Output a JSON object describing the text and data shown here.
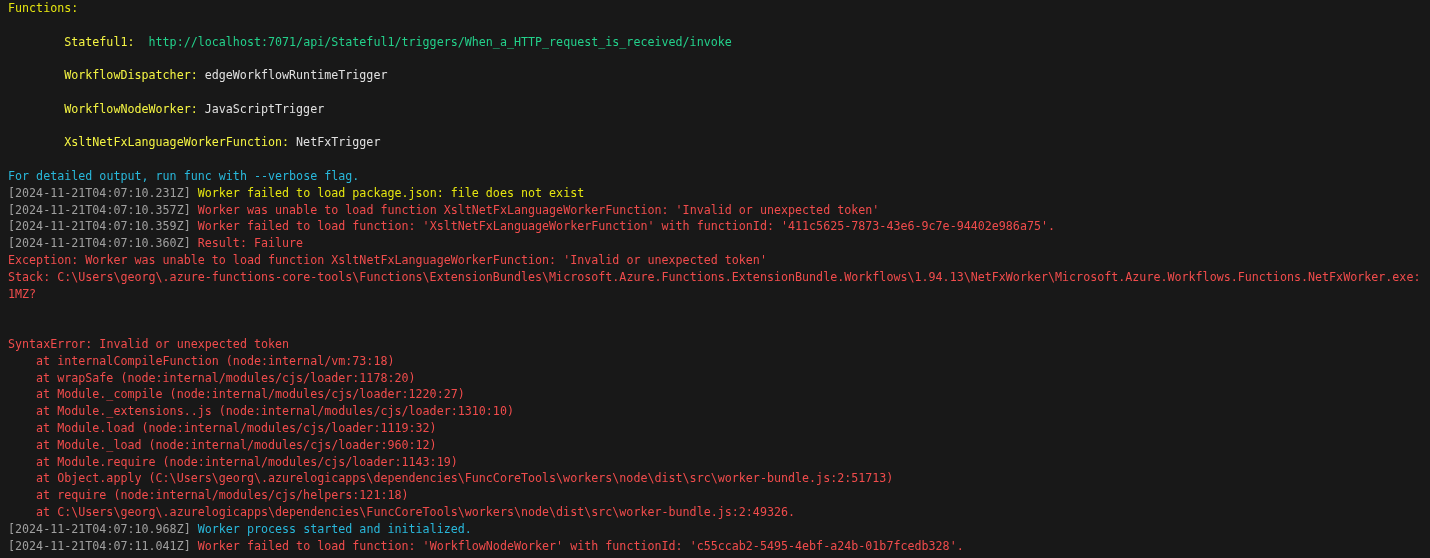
{
  "functions": {
    "heading": "Functions:",
    "items": [
      {
        "name": "Stateful1:",
        "trigger": "http://localhost:7071/api/Stateful1/triggers/When_a_HTTP_request_is_received/invoke",
        "kind": "url"
      },
      {
        "name": "WorkflowDispatcher:",
        "trigger": "edgeWorkflowRuntimeTrigger",
        "kind": "text"
      },
      {
        "name": "WorkflowNodeWorker:",
        "trigger": "JavaScriptTrigger",
        "kind": "text"
      },
      {
        "name": "XsltNetFxLanguageWorkerFunction:",
        "trigger": "NetFxTrigger",
        "kind": "text"
      }
    ]
  },
  "hint": "For detailed output, run func with --verbose flag.",
  "log": [
    {
      "kind": "entry",
      "timestamp": "[2024-11-21T04:07:10.231Z]",
      "message": "Worker failed to load package.json: file does not exist",
      "color": "#e5e510"
    },
    {
      "kind": "entry",
      "timestamp": "[2024-11-21T04:07:10.357Z]",
      "message": "Worker was unable to load function XsltNetFxLanguageWorkerFunction: 'Invalid or unexpected token'",
      "color": "#f14c4c"
    },
    {
      "kind": "entry",
      "timestamp": "[2024-11-21T04:07:10.359Z]",
      "message": "Worker failed to load function: 'XsltNetFxLanguageWorkerFunction' with functionId: '411c5625-7873-43e6-9c7e-94402e986a75'.",
      "color": "#f14c4c"
    },
    {
      "kind": "entry",
      "timestamp": "[2024-11-21T04:07:10.360Z]",
      "message": "Result: Failure",
      "color": "#f14c4c"
    },
    {
      "kind": "text",
      "text": "Exception: Worker was unable to load function XsltNetFxLanguageWorkerFunction: 'Invalid or unexpected token'",
      "color": "#f14c4c"
    },
    {
      "kind": "text",
      "text": "Stack: C:\\Users\\georg\\.azure-functions-core-tools\\Functions\\ExtensionBundles\\Microsoft.Azure.Functions.ExtensionBundle.Workflows\\1.94.13\\NetFxWorker\\Microsoft.Azure.Workflows.Functions.NetFxWorker.exe:1MZ?",
      "color": "#f14c4c"
    },
    {
      "kind": "gap"
    },
    {
      "kind": "gap"
    },
    {
      "kind": "text",
      "text": "SyntaxError: Invalid or unexpected token",
      "color": "#f14c4c"
    },
    {
      "kind": "frame",
      "text": "at internalCompileFunction (node:internal/vm:73:18)",
      "color": "#f14c4c"
    },
    {
      "kind": "frame",
      "text": "at wrapSafe (node:internal/modules/cjs/loader:1178:20)",
      "color": "#f14c4c"
    },
    {
      "kind": "frame",
      "text": "at Module._compile (node:internal/modules/cjs/loader:1220:27)",
      "color": "#f14c4c"
    },
    {
      "kind": "frame",
      "text": "at Module._extensions..js (node:internal/modules/cjs/loader:1310:10)",
      "color": "#f14c4c"
    },
    {
      "kind": "frame",
      "text": "at Module.load (node:internal/modules/cjs/loader:1119:32)",
      "color": "#f14c4c"
    },
    {
      "kind": "frame",
      "text": "at Module._load (node:internal/modules/cjs/loader:960:12)",
      "color": "#f14c4c"
    },
    {
      "kind": "frame",
      "text": "at Module.require (node:internal/modules/cjs/loader:1143:19)",
      "color": "#f14c4c"
    },
    {
      "kind": "frame",
      "text": "at Object.apply (C:\\Users\\georg\\.azurelogicapps\\dependencies\\FuncCoreTools\\workers\\node\\dist\\src\\worker-bundle.js:2:51713)",
      "color": "#f14c4c"
    },
    {
      "kind": "frame",
      "text": "at require (node:internal/modules/cjs/helpers:121:18)",
      "color": "#f14c4c"
    },
    {
      "kind": "frame",
      "text": "at C:\\Users\\georg\\.azurelogicapps\\dependencies\\FuncCoreTools\\workers\\node\\dist\\src\\worker-bundle.js:2:49326.",
      "color": "#f14c4c"
    },
    {
      "kind": "entry",
      "timestamp": "[2024-11-21T04:07:10.968Z]",
      "message": "Worker process started and initialized.",
      "color": "#29b8db"
    },
    {
      "kind": "entry",
      "timestamp": "[2024-11-21T04:07:11.041Z]",
      "message": "Worker failed to load function: 'WorkflowNodeWorker' with functionId: 'c55ccab2-5495-4ebf-a24b-01b7fcedb328'.",
      "color": "#f14c4c"
    }
  ]
}
